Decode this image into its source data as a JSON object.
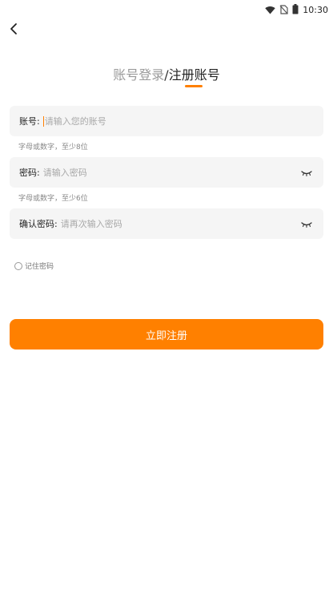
{
  "status_bar": {
    "time": "10:30",
    "icons": [
      "wifi-icon",
      "no-sim-icon",
      "battery-icon"
    ]
  },
  "header": {
    "back_icon": "chevron-left-icon"
  },
  "tabs": {
    "login_label": "账号登录",
    "separator": "/",
    "register_label": "注册账号",
    "active": "register"
  },
  "form": {
    "account": {
      "label": "账号:",
      "placeholder": "请输入您的账号",
      "value": "",
      "hint": "字母或数字，至少8位"
    },
    "password": {
      "label": "密码:",
      "placeholder": "请输入密码",
      "value": "",
      "hint": "字母或数字，至少6位",
      "toggle_icon": "eye-closed-icon"
    },
    "confirm_password": {
      "label": "确认密码:",
      "placeholder": "请再次输入密码",
      "value": "",
      "toggle_icon": "eye-closed-icon"
    },
    "remember_label": "记住密码",
    "remember_checked": false,
    "submit_label": "立即注册"
  },
  "colors": {
    "accent": "#ff8000",
    "field_bg": "#f5f5f5",
    "muted_text": "#9a9a9a"
  }
}
